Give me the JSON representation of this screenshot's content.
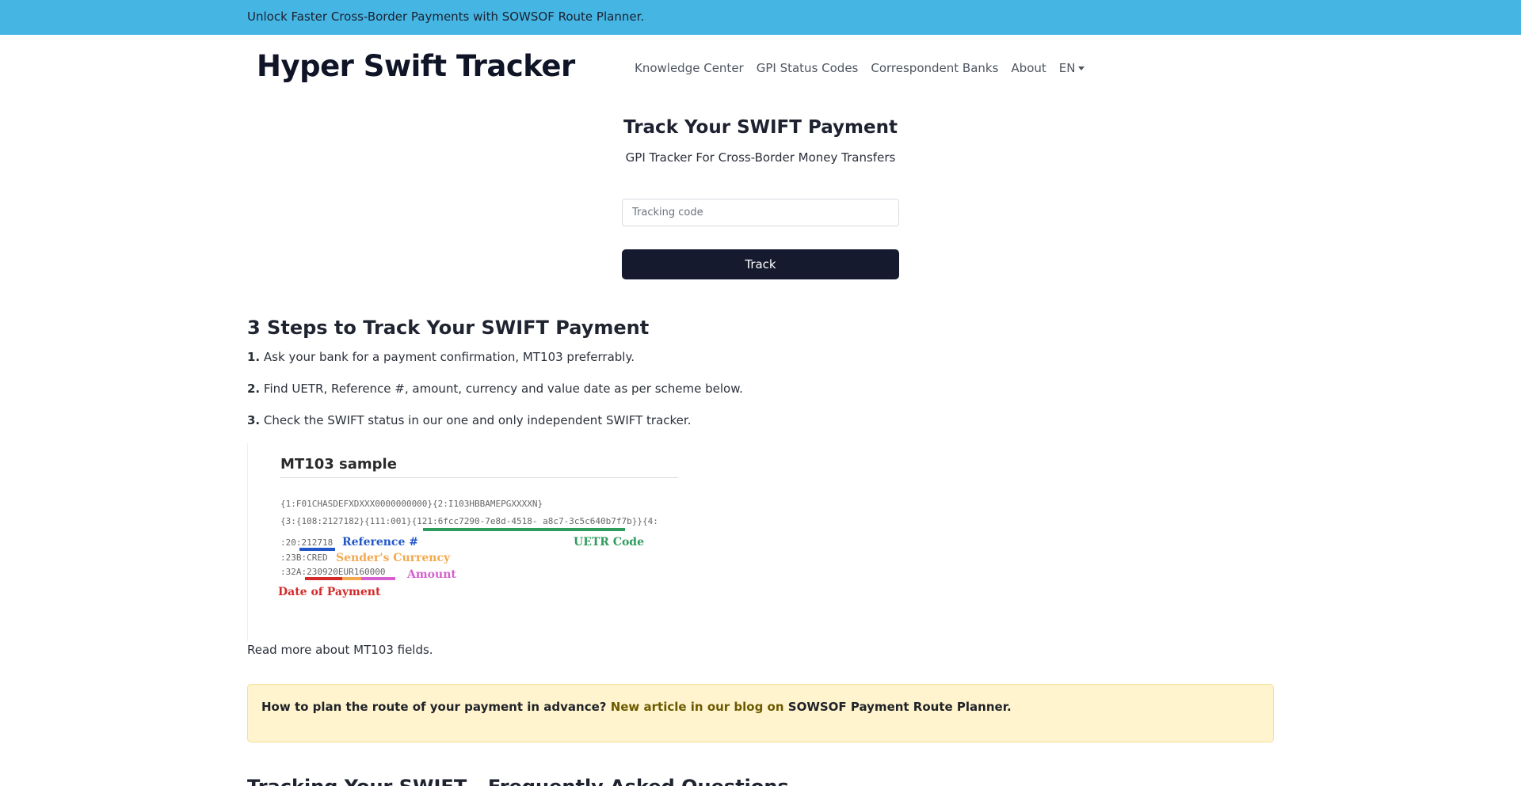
{
  "banner": {
    "text": "Unlock Faster Cross-Border Payments with SOWSOF Route Planner."
  },
  "header": {
    "brand": "Hyper Swift Tracker",
    "nav": [
      {
        "label": "Knowledge Center"
      },
      {
        "label": "GPI Status Codes"
      },
      {
        "label": "Correspondent Banks"
      },
      {
        "label": "About"
      }
    ],
    "language": "EN"
  },
  "hero": {
    "title": "Track Your SWIFT Payment",
    "subtitle": "GPI Tracker For Cross-Border Money Transfers",
    "input_placeholder": "Tracking code",
    "input_value": "",
    "button_label": "Track"
  },
  "steps": {
    "heading": "3 Steps to Track Your SWIFT Payment",
    "items": [
      {
        "num": "1.",
        "text": "Ask your bank for a payment confirmation, MT103 preferrably."
      },
      {
        "num": "2.",
        "text": "Find UETR, Reference #, amount, currency and value date as per scheme below."
      },
      {
        "num": "3.",
        "text": "Check the SWIFT status in our one and only independent SWIFT tracker."
      }
    ]
  },
  "mt103": {
    "title": "MT103 sample",
    "line1": "{1:F01CHASDEFXDXXX0000000000}{2:I103HBBAMEPGXXXXN}",
    "line2_prefix": "{3:{108:2127182}{111:001}{121:",
    "line2_uetr": "6fcc7290-7e8d-4518- a8c7-3c5c640b7f7b",
    "line2_suffix": "}}{4:",
    "line3_prefix": ":20:",
    "line3_ref": "212718",
    "line4": ":23B:CRED",
    "line5_prefix": ":32A:",
    "line5_date": "230920",
    "line5_currency": "EUR",
    "line5_amount": "160000",
    "labels": {
      "reference": "Reference #",
      "uetr": "UETR Code",
      "currency": "Sender's Currency",
      "amount": "Amount",
      "date": "Date of Payment"
    },
    "colors": {
      "reference": "#2257c9",
      "uetr": "#2e9c5c",
      "currency": "#f2a950",
      "amount": "#d660d0",
      "date": "#d42a2a"
    }
  },
  "read_more": "Read more about MT103 fields.",
  "alert": {
    "question": "How to plan the route of your payment in advance?",
    "link_text": "New article in our blog on",
    "tail": "SOWSOF Payment Route Planner",
    "end": "."
  },
  "faq": {
    "heading": "Tracking Your SWIFT - Frequently Asked Questions"
  }
}
